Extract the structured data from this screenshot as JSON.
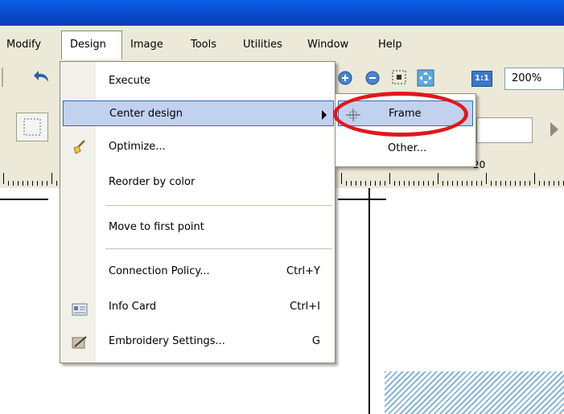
{
  "menubar": {
    "items": [
      {
        "label": "Modify",
        "u": "M"
      },
      {
        "label": "Design",
        "u": "D"
      },
      {
        "label": "Image",
        "u": "I"
      },
      {
        "label": "Tools",
        "u": "T"
      },
      {
        "label": "Utilities",
        "u": "U"
      },
      {
        "label": "Window",
        "u": "W"
      },
      {
        "label": "Help",
        "u": "H"
      }
    ]
  },
  "toolbar": {
    "zoom_value": "200%",
    "zoom_11": "1:1"
  },
  "ruler": {
    "label": "20"
  },
  "design_menu": {
    "items": [
      {
        "label": "Execute",
        "shortcut": ""
      },
      {
        "label": "Center design",
        "shortcut": ""
      },
      {
        "label": "Optimize...",
        "shortcut": ""
      },
      {
        "label": "Reorder by color",
        "shortcut": ""
      },
      {
        "label": "Move to first point",
        "shortcut": ""
      },
      {
        "label": "Connection Policy...",
        "shortcut": "Ctrl+Y"
      },
      {
        "label": "Info Card",
        "shortcut": "Ctrl+I"
      },
      {
        "label": "Embroidery Settings...",
        "shortcut": "G"
      }
    ]
  },
  "center_submenu": {
    "items": [
      {
        "label": "Frame"
      },
      {
        "label": "Other..."
      }
    ]
  },
  "colors": {
    "highlight": "#c1d2ee",
    "highlight_border": "#316ac5",
    "annotation_ring": "#e0181c",
    "titlebar": "#0a5fe8"
  }
}
